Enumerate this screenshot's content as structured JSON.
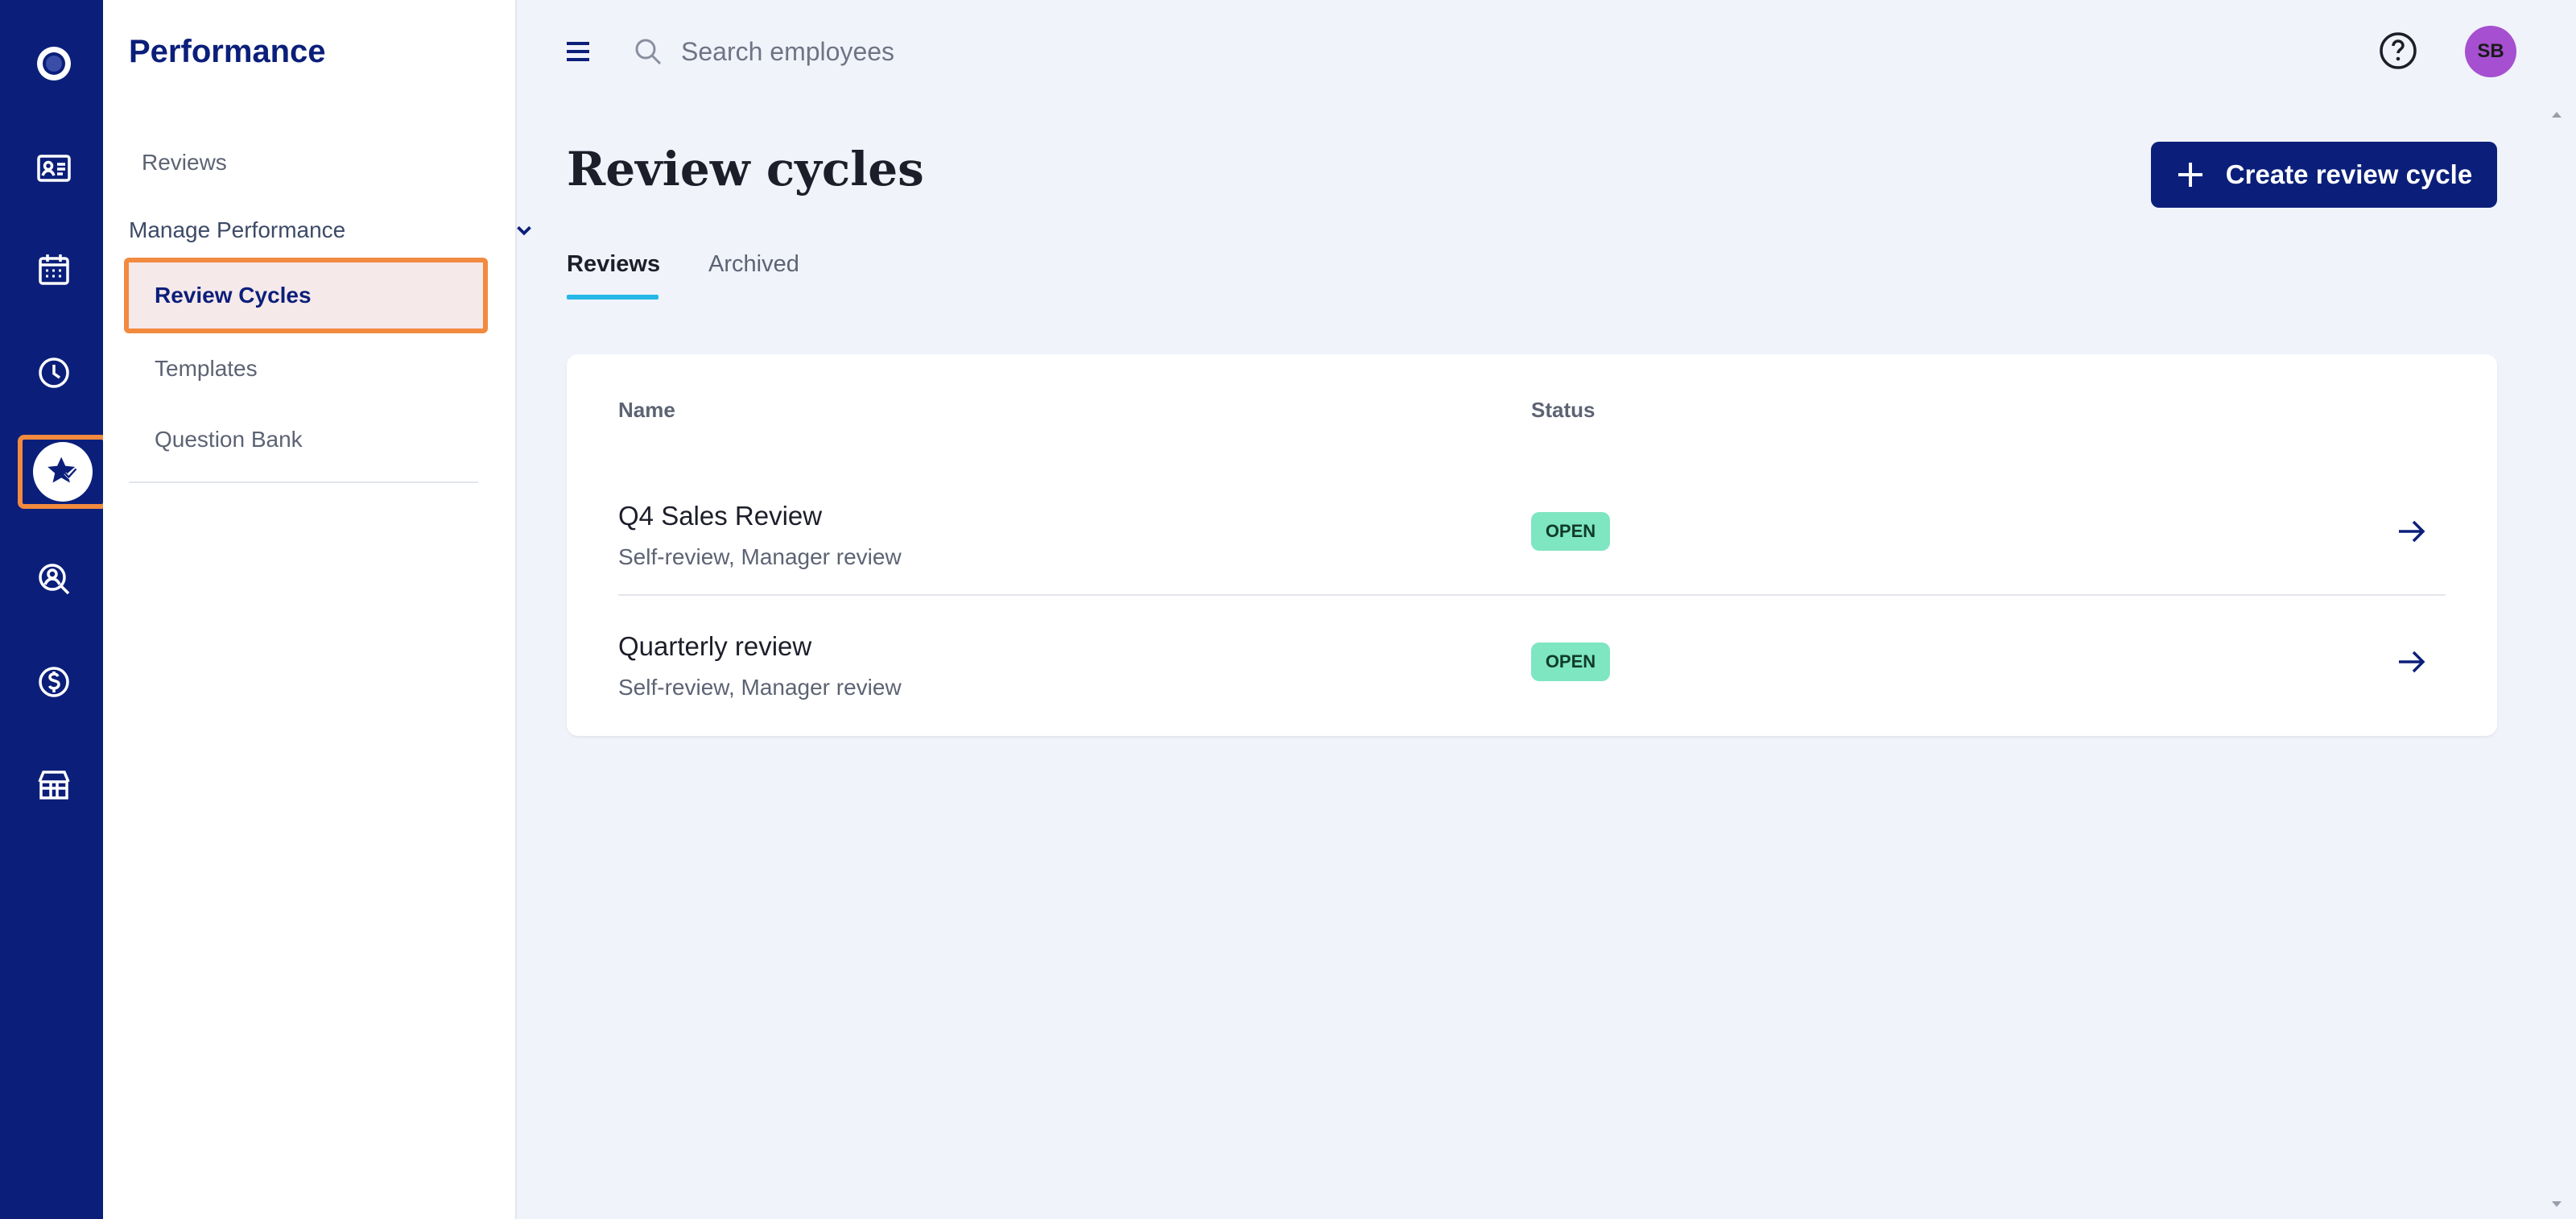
{
  "rail": {
    "items": [
      {
        "icon": "logo-icon"
      },
      {
        "icon": "contact-card-icon"
      },
      {
        "icon": "calendar-icon"
      },
      {
        "icon": "clock-icon"
      },
      {
        "icon": "star-performance-icon",
        "active": true
      },
      {
        "icon": "person-search-icon"
      },
      {
        "icon": "dollar-icon"
      },
      {
        "icon": "storefront-icon"
      }
    ]
  },
  "sidebar": {
    "title": "Performance",
    "reviews_label": "Reviews",
    "group_label": "Manage Performance",
    "items": [
      {
        "label": "Review Cycles",
        "active": true
      },
      {
        "label": "Templates"
      },
      {
        "label": "Question Bank"
      }
    ]
  },
  "topbar": {
    "search_placeholder": "Search employees",
    "avatar_initials": "SB"
  },
  "page": {
    "title": "Review cycles",
    "create_button": "Create review cycle",
    "tabs": [
      {
        "label": "Reviews",
        "active": true
      },
      {
        "label": "Archived"
      }
    ]
  },
  "table": {
    "columns": [
      "Name",
      "Status"
    ],
    "rows": [
      {
        "name": "Q4 Sales Review",
        "subtitle": "Self-review, Manager review",
        "status": "OPEN"
      },
      {
        "name": "Quarterly review",
        "subtitle": "Self-review, Manager review",
        "status": "OPEN"
      }
    ]
  },
  "colors": {
    "rail_bg": "#0b1f7a",
    "accent": "#0b1f7a",
    "highlight_border": "#f28a3f",
    "tab_underline": "#25b7e6",
    "badge_open": "#7ee6c1",
    "avatar_bg": "#a64fd0"
  }
}
